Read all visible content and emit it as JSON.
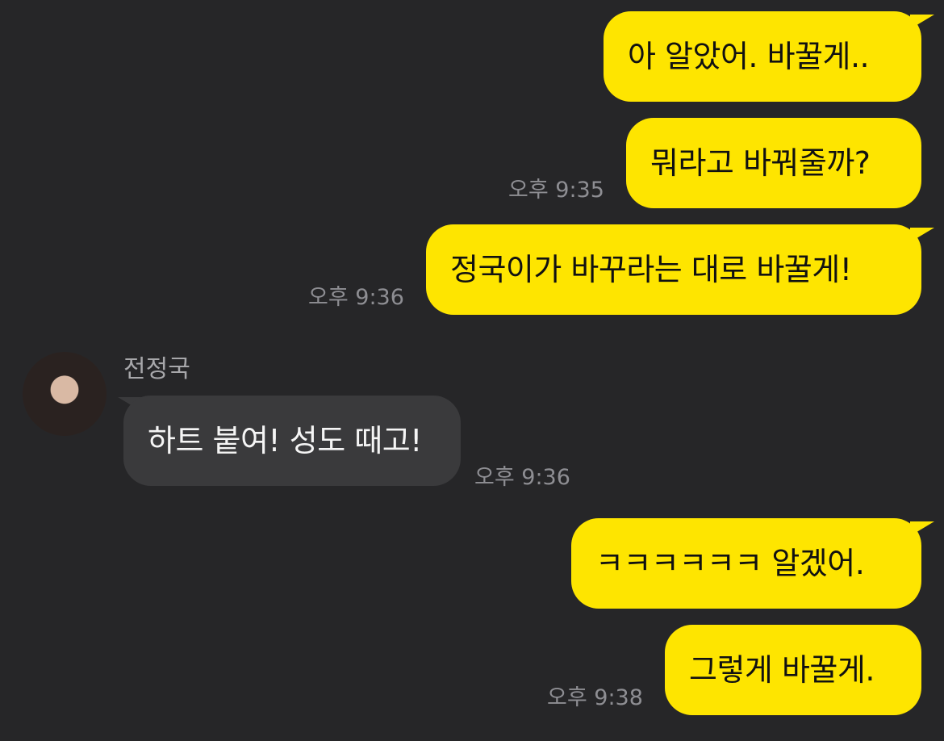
{
  "colors": {
    "background": "#262628",
    "my_bubble": "#fee500",
    "their_bubble": "#3a3a3c",
    "timestamp": "#8e8e93"
  },
  "contact": {
    "name": "전정국",
    "avatar_icon": "profile-photo"
  },
  "messages": [
    {
      "from": "me",
      "text": "아 알았어. 바꿀게..",
      "time": ""
    },
    {
      "from": "me",
      "text": "뭐라고 바꿔줄까?",
      "time": "오후 9:35"
    },
    {
      "from": "me",
      "text": "정국이가 바꾸라는 대로 바꿀게!",
      "time": "오후 9:36"
    },
    {
      "from": "them",
      "text": "하트 붙여! 성도 때고!",
      "time": "오후 9:36"
    },
    {
      "from": "me",
      "text": "ㅋㅋㅋㅋㅋㅋ 알겠어.",
      "time": ""
    },
    {
      "from": "me",
      "text": "그렇게 바꿀게.",
      "time": "오후 9:38"
    }
  ]
}
